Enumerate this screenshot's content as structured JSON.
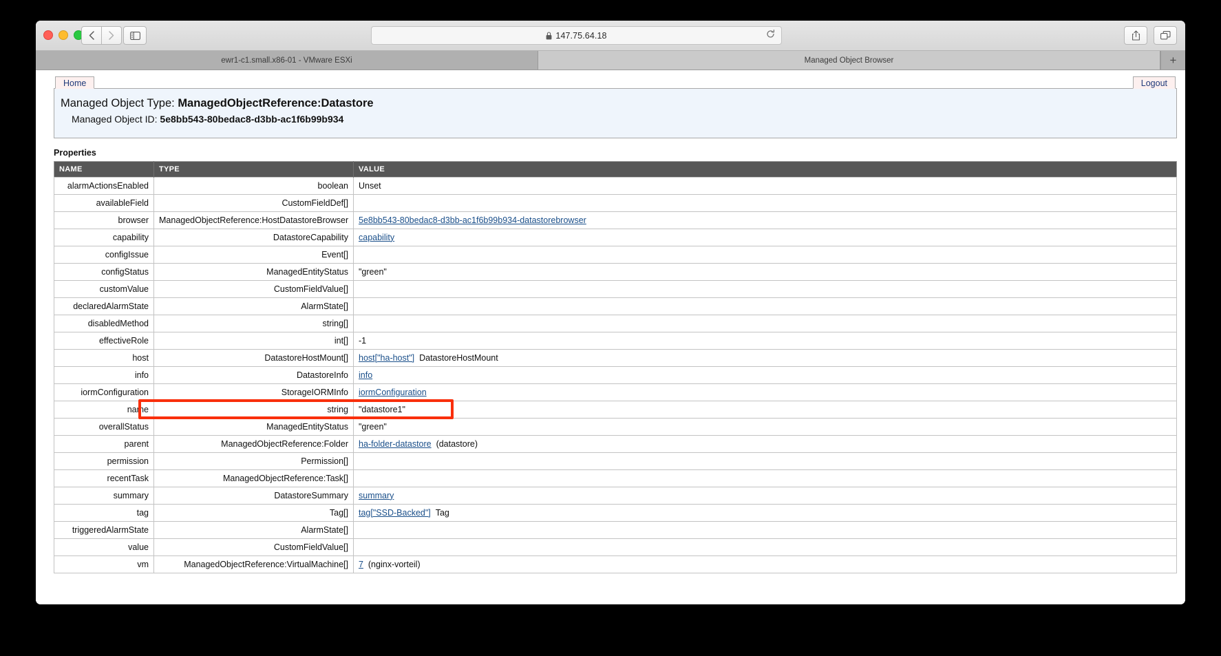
{
  "browser": {
    "url": "147.75.64.18",
    "lock_icon": "lock-icon",
    "reload_icon": "reload-icon",
    "back_icon": "chevron-left-icon",
    "forward_icon": "chevron-right-icon",
    "sidebar_icon": "sidebar-toggle-icon",
    "share_icon": "share-icon",
    "tabs_overview_icon": "tabs-overview-icon",
    "new_tab_label": "+",
    "tabs": [
      {
        "label": "ewr1-c1.small.x86-01 - VMware ESXi",
        "active": false
      },
      {
        "label": "Managed Object Browser",
        "active": true
      }
    ]
  },
  "page": {
    "nav": {
      "home_label": "Home",
      "logout_label": "Logout"
    },
    "header": {
      "type_label": "Managed Object Type:",
      "type_value": "ManagedObjectReference:Datastore",
      "id_label": "Managed Object ID:",
      "id_value": "5e8bb543-80bedac8-d3bb-ac1f6b99b934"
    },
    "properties_title": "Properties",
    "table": {
      "columns": [
        "NAME",
        "TYPE",
        "VALUE"
      ],
      "rows": [
        {
          "name": "alarmActionsEnabled",
          "type": "boolean",
          "value_link": "",
          "value_text": "Unset"
        },
        {
          "name": "availableField",
          "type": "CustomFieldDef[]",
          "value_link": "",
          "value_text": ""
        },
        {
          "name": "browser",
          "type": "ManagedObjectReference:HostDatastoreBrowser",
          "value_link": "5e8bb543-80bedac8-d3bb-ac1f6b99b934-datastorebrowser",
          "value_text": ""
        },
        {
          "name": "capability",
          "type": "DatastoreCapability",
          "value_link": "capability",
          "value_text": ""
        },
        {
          "name": "configIssue",
          "type": "Event[]",
          "value_link": "",
          "value_text": ""
        },
        {
          "name": "configStatus",
          "type": "ManagedEntityStatus",
          "value_link": "",
          "value_text": "\"green\""
        },
        {
          "name": "customValue",
          "type": "CustomFieldValue[]",
          "value_link": "",
          "value_text": ""
        },
        {
          "name": "declaredAlarmState",
          "type": "AlarmState[]",
          "value_link": "",
          "value_text": ""
        },
        {
          "name": "disabledMethod",
          "type": "string[]",
          "value_link": "",
          "value_text": ""
        },
        {
          "name": "effectiveRole",
          "type": "int[]",
          "value_link": "",
          "value_text": "-1"
        },
        {
          "name": "host",
          "type": "DatastoreHostMount[]",
          "value_link": "host[\"ha-host\"]",
          "value_text": "DatastoreHostMount"
        },
        {
          "name": "info",
          "type": "DatastoreInfo",
          "value_link": "info",
          "value_text": ""
        },
        {
          "name": "iormConfiguration",
          "type": "StorageIORMInfo",
          "value_link": "iormConfiguration",
          "value_text": ""
        },
        {
          "name": "name",
          "type": "string",
          "value_link": "",
          "value_text": "\"datastore1\"",
          "highlighted": true
        },
        {
          "name": "overallStatus",
          "type": "ManagedEntityStatus",
          "value_link": "",
          "value_text": "\"green\""
        },
        {
          "name": "parent",
          "type": "ManagedObjectReference:Folder",
          "value_link": "ha-folder-datastore",
          "value_text": "(datastore)"
        },
        {
          "name": "permission",
          "type": "Permission[]",
          "value_link": "",
          "value_text": ""
        },
        {
          "name": "recentTask",
          "type": "ManagedObjectReference:Task[]",
          "value_link": "",
          "value_text": ""
        },
        {
          "name": "summary",
          "type": "DatastoreSummary",
          "value_link": "summary",
          "value_text": ""
        },
        {
          "name": "tag",
          "type": "Tag[]",
          "value_link": "tag[\"SSD-Backed\"]",
          "value_text": "Tag"
        },
        {
          "name": "triggeredAlarmState",
          "type": "AlarmState[]",
          "value_link": "",
          "value_text": ""
        },
        {
          "name": "value",
          "type": "CustomFieldValue[]",
          "value_link": "",
          "value_text": ""
        },
        {
          "name": "vm",
          "type": "ManagedObjectReference:VirtualMachine[]",
          "value_link": "7",
          "value_text": "(nginx-vorteil)"
        }
      ]
    }
  },
  "annotation": {
    "color": "#f92f0c",
    "target_row": "name"
  }
}
